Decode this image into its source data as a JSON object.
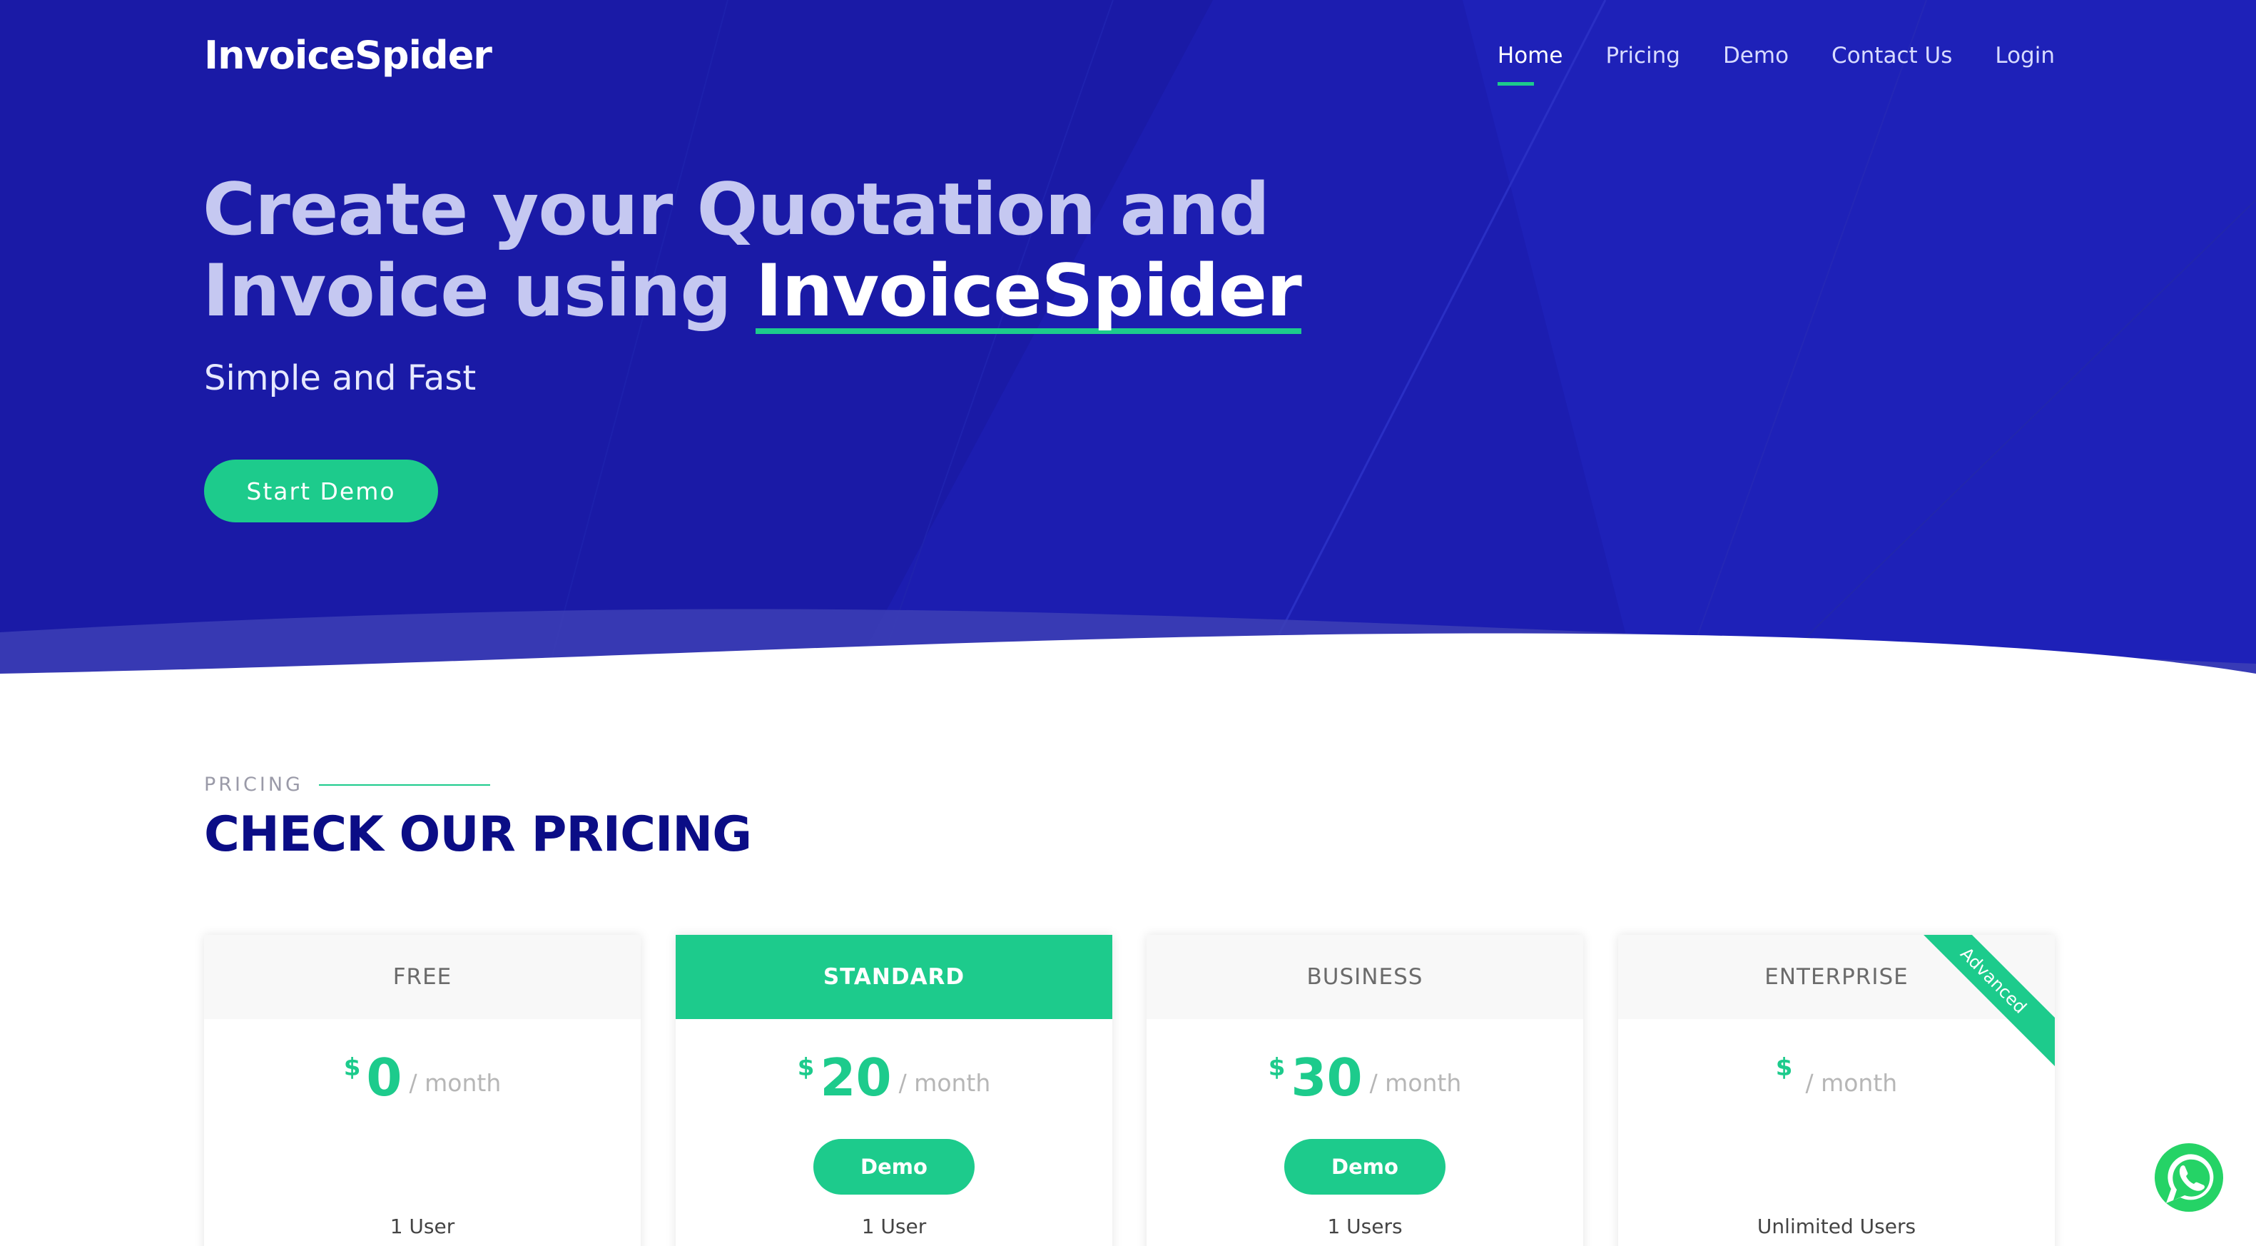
{
  "header": {
    "logo": "InvoiceSpider",
    "nav": [
      {
        "label": "Home",
        "active": true
      },
      {
        "label": "Pricing",
        "active": false
      },
      {
        "label": "Demo",
        "active": false
      },
      {
        "label": "Contact Us",
        "active": false
      },
      {
        "label": "Login",
        "active": false
      }
    ]
  },
  "hero": {
    "headline_line1": "Create your Quotation and",
    "headline_line2_prefix": "Invoice using ",
    "headline_brand": "InvoiceSpider",
    "subtitle": "Simple and Fast",
    "cta_label": "Start Demo"
  },
  "pricing": {
    "kicker": "PRICING",
    "title": "CHECK OUR PRICING",
    "plans": [
      {
        "name": "FREE",
        "currency": "$",
        "amount": "0",
        "period": "/ month",
        "button": "",
        "users": "1 User",
        "featured": false,
        "ribbon": ""
      },
      {
        "name": "STANDARD",
        "currency": "$",
        "amount": "20",
        "period": "/ month",
        "button": "Demo",
        "users": "1 User",
        "featured": true,
        "ribbon": ""
      },
      {
        "name": "BUSINESS",
        "currency": "$",
        "amount": "30",
        "period": "/ month",
        "button": "Demo",
        "users": "1 Users",
        "featured": false,
        "ribbon": ""
      },
      {
        "name": "ENTERPRISE",
        "currency": "$",
        "amount": "",
        "period": "/ month",
        "button": "",
        "users": "Unlimited Users",
        "featured": false,
        "ribbon": "Advanced"
      }
    ]
  },
  "floating": {
    "icon": "whatsapp-icon"
  },
  "colors": {
    "hero_bg": "#1a1aa6",
    "accent": "#1dcb8c",
    "title": "#0b0d86"
  }
}
